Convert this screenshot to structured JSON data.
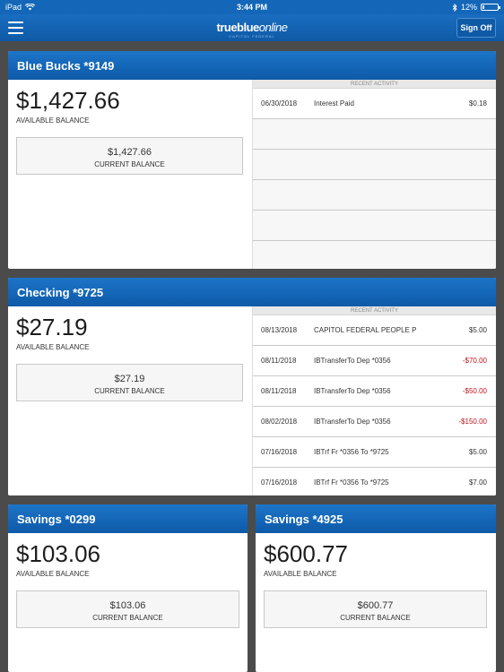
{
  "status_bar": {
    "device": "iPad",
    "time": "3:44 PM",
    "battery": "12%",
    "battery_level": 0.12
  },
  "nav": {
    "logo_main": "trueblue",
    "logo_online": "online",
    "logo_sub": "CAPITOL FEDERAL",
    "signoff_label": "Sign Off"
  },
  "labels": {
    "available_balance": "AVAILABLE BALANCE",
    "current_balance": "CURRENT BALANCE",
    "recent_activity": "RECENT ACTIVITY"
  },
  "accounts": [
    {
      "name": "Blue Bucks *9149",
      "available": "$1,427.66",
      "current": "$1,427.66",
      "activity": [
        {
          "date": "06/30/2018",
          "desc": "Interest Paid",
          "amount": "$0.18"
        }
      ]
    },
    {
      "name": "Checking *9725",
      "available": "$27.19",
      "current": "$27.19",
      "activity": [
        {
          "date": "08/13/2018",
          "desc": "CAPITOL FEDERAL  PEOPLE P",
          "amount": "$5.00"
        },
        {
          "date": "08/11/2018",
          "desc": "IBTransferTo Dep *0356",
          "amount": "-$70.00"
        },
        {
          "date": "08/11/2018",
          "desc": "IBTransferTo Dep *0356",
          "amount": "-$50.00"
        },
        {
          "date": "08/02/2018",
          "desc": "IBTransferTo Dep *0356",
          "amount": "-$150.00"
        },
        {
          "date": "07/16/2018",
          "desc": "IBTrf Fr *0356 To *9725",
          "amount": "$5.00"
        },
        {
          "date": "07/16/2018",
          "desc": "IBTrf Fr *0356 To *9725",
          "amount": "$7.00"
        }
      ]
    },
    {
      "name": "Savings *0299",
      "available": "$103.06",
      "current": "$103.06"
    },
    {
      "name": "Savings *4925",
      "available": "$600.77",
      "current": "$600.77"
    }
  ]
}
